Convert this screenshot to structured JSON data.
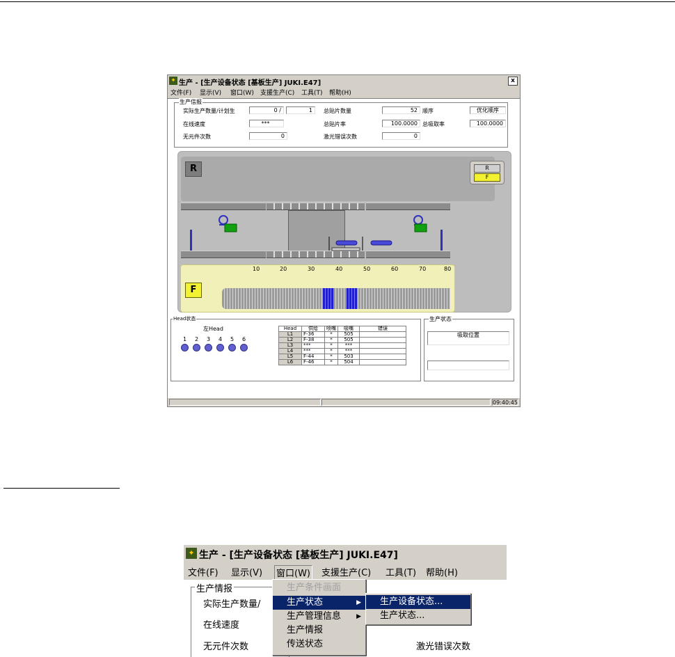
{
  "window": {
    "title": "生产 - [生产设备状态 [基板生产] JUKI.E47]",
    "close_label": "x",
    "menu": [
      "文件(F)",
      "显示(V)",
      "窗口(W)",
      "支援生产(C)",
      "工具(T)",
      "帮助(H)"
    ],
    "info": {
      "group_label": "生产信报",
      "actual_plan_label": "实际生产数量/计划生",
      "actual_value": "0 /",
      "plan_value": "1",
      "online_speed_label": "在线速度",
      "online_speed_value": "***",
      "no_part_label": "无元件次数",
      "no_part_value": "0",
      "total_mount_label": "总贴片数量",
      "total_mount_value": "52",
      "order_label": "顺序",
      "order_value": "优化顺序",
      "total_rate_label": "总贴片率",
      "total_rate_value": "100.0000",
      "pick_rate_label": "总吸取率",
      "pick_rate_value": "100.0000",
      "laser_label": "激光错误次数",
      "laser_value": "0"
    },
    "diagram": {
      "r_label": "R",
      "f_label": "F",
      "rf_buttons": [
        "R",
        "F"
      ],
      "scale": [
        "10",
        "20",
        "30",
        "40",
        "50",
        "60",
        "70",
        "80"
      ]
    },
    "head_status": {
      "group_label": "Head状态",
      "left_head_label": "左Head",
      "head_numbers": [
        "1",
        "2",
        "3",
        "4",
        "5",
        "6"
      ]
    },
    "head_table": {
      "columns": [
        "Head",
        "供给",
        "喷嘴",
        "吸嘴",
        "错误"
      ],
      "rows": [
        [
          "L1",
          "F-36",
          "*",
          "505",
          ""
        ],
        [
          "L2",
          "F-38",
          "*",
          "505",
          ""
        ],
        [
          "L3",
          "***",
          "*",
          "***",
          ""
        ],
        [
          "L4",
          "***",
          "*",
          "***",
          ""
        ],
        [
          "L5",
          "F-44",
          "*",
          "503",
          ""
        ],
        [
          "L6",
          "F-46",
          "*",
          "504",
          ""
        ]
      ]
    },
    "production_state": {
      "group_label": "生产状态",
      "value": "吸取位置"
    },
    "status_time": "09:40:45"
  },
  "zoom": {
    "title": "生产 - [生产设备状态 [基板生产] JUKI.E47]",
    "menu": [
      "文件(F)",
      "显示(V)",
      "窗口(W)",
      "支援生产(C)",
      "工具(T)",
      "帮助(H)"
    ],
    "group_label": "生产情报",
    "labels": [
      "实际生产数量/",
      "在线速度",
      "无元件次数"
    ],
    "right_label": "激光错误次数",
    "window_menu_items": [
      "生产条件画面",
      "生产状态",
      "生产管理信息",
      "生产情报",
      "传送状态"
    ],
    "submenu_items": [
      "生产设备状态...",
      "生产状态..."
    ]
  }
}
